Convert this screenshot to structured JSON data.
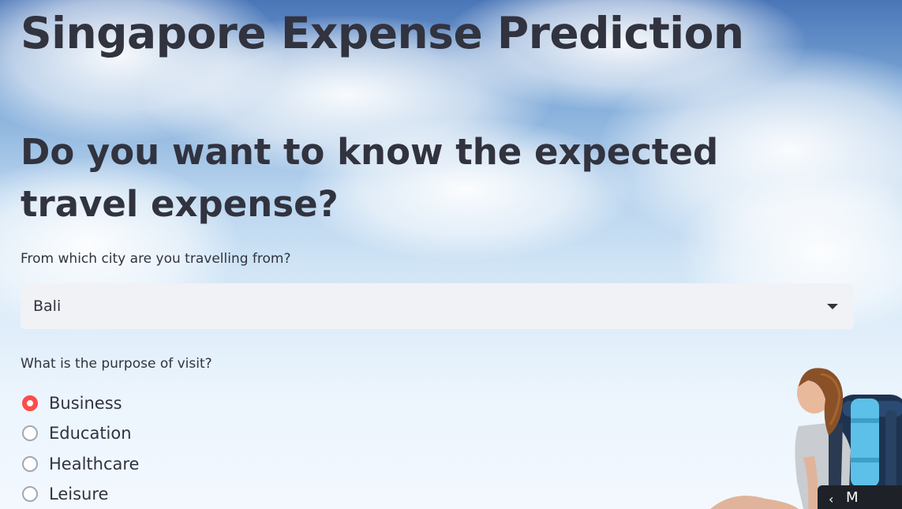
{
  "page": {
    "title": "Singapore Expense Prediction",
    "subtitle": "Do you want to know the expected travel expense?"
  },
  "city": {
    "label": "From which city are you travelling from?",
    "selected": "Bali"
  },
  "purpose": {
    "label": "What is the purpose of visit?",
    "options": [
      "Business",
      "Education",
      "Healthcare",
      "Leisure"
    ],
    "selected_index": 0
  },
  "colors": {
    "accent": "#ff4b4b",
    "text": "#31333f",
    "select_bg": "#f0f2f6"
  },
  "icons": {
    "select_caret": "caret-down-icon",
    "corner": "chevron-left-icon"
  },
  "corner_button": {
    "label": "M"
  }
}
